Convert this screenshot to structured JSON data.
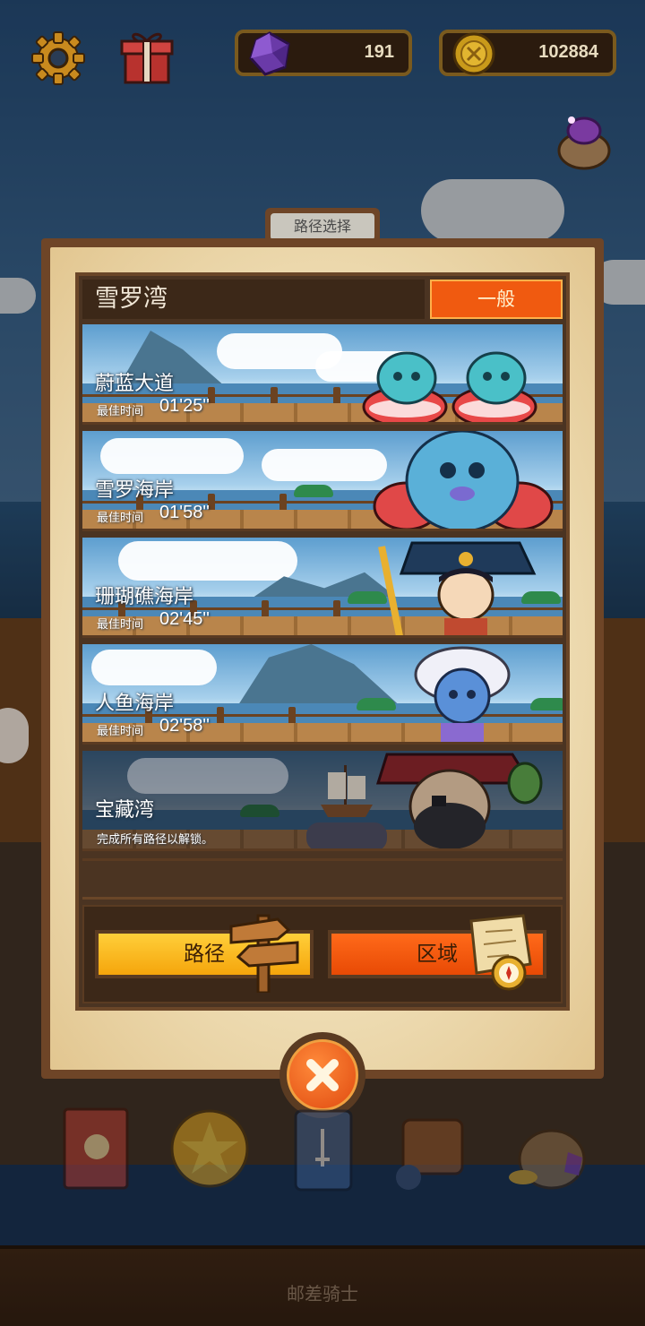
{
  "hud": {
    "gems": "191",
    "coins": "102884"
  },
  "panel": {
    "tab_title": "路径选择",
    "region_name": "雪罗湾",
    "difficulty": "一般",
    "routes": [
      {
        "name": "蔚蓝大道",
        "best_label": "最佳时间",
        "best_time": "01'25''",
        "locked": false
      },
      {
        "name": "雪罗海岸",
        "best_label": "最佳时间",
        "best_time": "01'58''",
        "locked": false
      },
      {
        "name": "珊瑚礁海岸",
        "best_label": "最佳时间",
        "best_time": "02'45''",
        "locked": false
      },
      {
        "name": "人鱼海岸",
        "best_label": "最佳时间",
        "best_time": "02'58''",
        "locked": false
      },
      {
        "name": "宝藏湾",
        "lock_msg": "完成所有路径以解锁。",
        "locked": true
      }
    ],
    "route_button": "路径",
    "area_button": "区域"
  },
  "footer": {
    "title": "邮差骑士"
  },
  "colors": {
    "accent_orange": "#f05a10",
    "accent_yellow": "#f5a50c",
    "panel_brown": "#6e4527"
  }
}
